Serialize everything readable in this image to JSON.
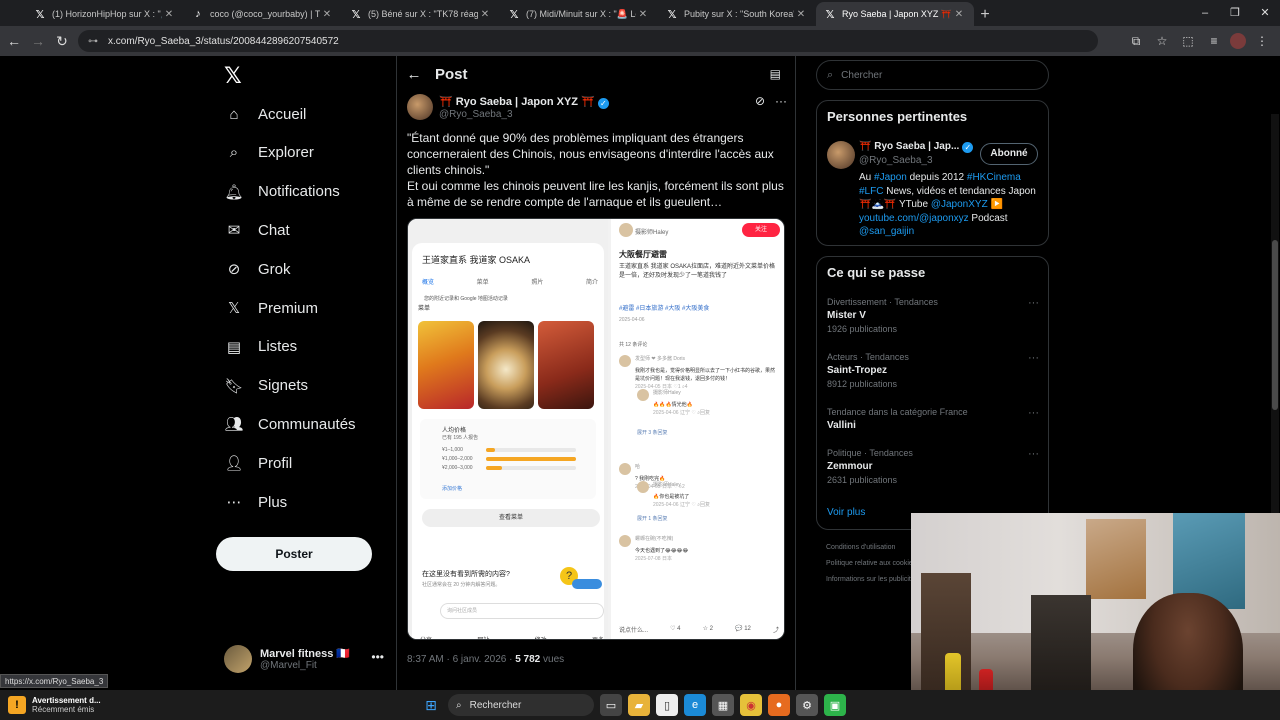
{
  "browser": {
    "tabs": [
      {
        "icon": "x-icon",
        "title": "(1) HorizonHipHop sur X : \"🚨 I"
      },
      {
        "icon": "tiktok-icon",
        "title": "coco (@coco_yourbaby) | TikTok"
      },
      {
        "icon": "x-icon",
        "title": "(5) Béné sur X : \"TK78 réagit à l"
      },
      {
        "icon": "x-icon",
        "title": "(7) Midi/Minuit sur X : \"🚨 Le S"
      },
      {
        "icon": "x-icon",
        "title": "Pubity sur X : \"South Korea's pr"
      },
      {
        "icon": "x-icon",
        "title": "Ryo Saeba | Japon XYZ ⛩️ sur"
      }
    ],
    "active_tab": 5,
    "url": "x.com/Ryo_Saeba_3/status/2008442896207540572",
    "status_url": "https://x.com/Ryo_Saeba_3"
  },
  "nav": {
    "items": [
      {
        "icon": "home-icon",
        "label": "Accueil"
      },
      {
        "icon": "search-icon",
        "label": "Explorer"
      },
      {
        "icon": "bell-icon",
        "label": "Notifications"
      },
      {
        "icon": "mail-icon",
        "label": "Chat"
      },
      {
        "icon": "grok-icon",
        "label": "Grok"
      },
      {
        "icon": "x-icon",
        "label": "Premium"
      },
      {
        "icon": "list-icon",
        "label": "Listes"
      },
      {
        "icon": "bookmark-icon",
        "label": "Signets"
      },
      {
        "icon": "community-icon",
        "label": "Communautés"
      },
      {
        "icon": "profile-icon",
        "label": "Profil"
      },
      {
        "icon": "more-icon",
        "label": "Plus"
      }
    ],
    "post_button": "Poster",
    "account": {
      "name": "Marvel fitness 🇫🇷",
      "handle": "@Marvel_Fit"
    }
  },
  "post": {
    "header_title": "Post",
    "author_name": "⛩️ Ryo Saeba | Japon XYZ ⛩️",
    "author_handle": "@Ryo_Saeba_3",
    "text_1": "\"Étant donné que 90% des problèmes impliquant des étrangers concerneraient des Chinois, nous envisageons d'interdire l'accès aux clients chinois.\"",
    "text_2": "Et oui comme les chinois peuvent lire les kanjis, forcément ils sont plus à même de se rendre compte de l'arnaque et ils gueulent…",
    "time": "8:37 AM · 6 janv. 2026 · ",
    "views_count": "5 782",
    "views_label": " vues",
    "media": {
      "left": {
        "store_title": "王道家直系 我道家 OSAKA",
        "tabs": [
          "概览",
          "菜单",
          "照片",
          "简介"
        ],
        "info": "您的附近记录和 Google 地图活动记录",
        "menu_label": "菜单",
        "price_title": "人均价格",
        "price_sub": "已有 195 人报告",
        "price_rows": [
          {
            "label": "¥1–1,000",
            "share": 0.1
          },
          {
            "label": "¥1,000–2,000",
            "share": 1.0
          },
          {
            "label": "¥2,000–3,000",
            "share": 0.18
          }
        ],
        "add_price": "添加价格",
        "view_menu": "查看菜单",
        "question": "在这里没有看到所需的内容?",
        "question_sub": "社区通常会在 20 分钟内解答问题。",
        "ask_placeholder": "询问社区成员",
        "tools": [
          "分享",
          "网站",
          "修改",
          "更多"
        ]
      },
      "right": {
        "user": "摄影师Haley",
        "follow": "关注",
        "title": "大阪餐厅避雷",
        "body": "王道家直系 我道家 OSAKA拉面店，难道附近外文菜单价格是一倍，还好及时发现少了一笔道我钱了",
        "tags": "#避雷 #日本旅游 #大阪 #大阪美食",
        "date": "2025-04-06",
        "comments_count": "共 12 条评论",
        "comments": [
          {
            "user": "发型师 ❤ 多多酱 Doris",
            "text": "我刚才我也是，觉得价格明显所以去了一下小红书的谷歌，果然是坑价问题！现在我退钱，退回多付的钱！",
            "meta": "2025-04-05 日本  ♡1  ⌕4"
          },
          {
            "user": "摄影师Haley",
            "text": "🔥🔥🔥情光他🔥",
            "meta": "2025-04-06 辽宁  ♡ ⌕回复"
          },
          {
            "user": "",
            "text": "展开 3 条回复",
            "meta": ""
          },
          {
            "user": "哈",
            "text": "? 我刚吃完🔥",
            "meta": "2025-04-05 日本  ♡ ⌕2"
          },
          {
            "user": "摄影师Haley",
            "text": "🔥你也是被坑了",
            "meta": "2025-04-06 辽宁  ♡ ⌕回复"
          },
          {
            "user": "",
            "text": "展开 1 条回复",
            "meta": ""
          },
          {
            "user": "螺蛳在碗(不吃辣)",
            "text": "今天也遇到了😂😂😂😂",
            "meta": "2025-07-08 日本"
          }
        ],
        "bottom": [
          "说点什么...",
          "♡ 4",
          "☆ 2",
          "💬 12",
          "⤴"
        ]
      }
    }
  },
  "right": {
    "search_placeholder": "Chercher",
    "relevant_title": "Personnes pertinentes",
    "relevant": {
      "name": "⛩️ Ryo Saeba | Jap...",
      "handle": "@Ryo_Saeba_3",
      "follow_label": "Abonné",
      "bio_parts": [
        {
          "t": "Au ",
          "link": false
        },
        {
          "t": "#Japon",
          "link": true
        },
        {
          "t": " depuis 2012 ",
          "link": false
        },
        {
          "t": "#HKCinema",
          "link": true
        },
        {
          "t": " ",
          "link": false
        },
        {
          "t": "#LFC",
          "link": true
        },
        {
          "t": " News, vidéos et tendances Japon ⛩️🗻⛩️ YTube ",
          "link": false
        },
        {
          "t": "@JaponXYZ",
          "link": true
        },
        {
          "t": " ▶️ ",
          "link": false
        },
        {
          "t": "youtube.com/@japonxyz",
          "link": true
        },
        {
          "t": " Podcast ",
          "link": false
        },
        {
          "t": "@san_gaijin",
          "link": true
        }
      ]
    },
    "trends_title": "Ce qui se passe",
    "trends": [
      {
        "category": "Divertissement · Tendances",
        "name": "Mister V",
        "count": "1926 publications"
      },
      {
        "category": "Acteurs · Tendances",
        "name": "Saint-Tropez",
        "count": "8912 publications"
      },
      {
        "category": "Tendance dans la catégorie France",
        "name": "Vallini",
        "count": ""
      },
      {
        "category": "Politique · Tendances",
        "name": "Zemmour",
        "count": "2631 publications"
      }
    ],
    "see_more": "Voir plus",
    "footer": [
      "Conditions d'utilisation",
      "Politique relative aux cookies",
      "Informations sur les publicités"
    ]
  },
  "taskbar": {
    "notification_title": "Avertissement d...",
    "notification_sub": "Récemment émis",
    "search_label": "Rechercher"
  }
}
